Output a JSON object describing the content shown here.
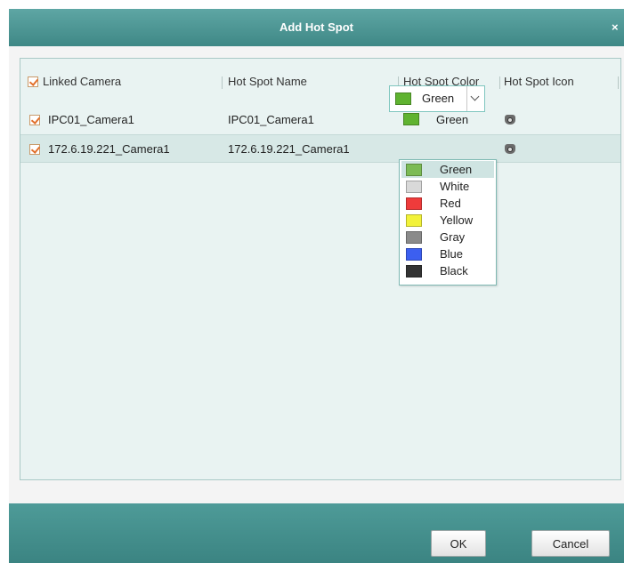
{
  "dialog": {
    "title": "Add Hot Spot",
    "close_glyph": "×"
  },
  "table": {
    "headers": {
      "linked_camera": "Linked Camera",
      "hot_spot_name": "Hot Spot Name",
      "hot_spot_color": "Hot Spot Color",
      "hot_spot_icon": "Hot Spot Icon"
    },
    "header_checked": true,
    "rows": [
      {
        "checked": true,
        "camera": "IPC01_Camera1",
        "name": "IPC01_Camera1",
        "color": "Green",
        "color_hex": "#5fb330",
        "icon": "camera-icon"
      },
      {
        "checked": true,
        "camera": "172.6.19.221_Camera1",
        "name": "172.6.19.221_Camera1",
        "color": "Green",
        "color_hex": "#5fb330",
        "icon": "camera-icon"
      }
    ]
  },
  "color_dropdown": {
    "selected": "Green",
    "options": [
      {
        "label": "Green",
        "hex": "#7cbb55"
      },
      {
        "label": "White",
        "hex": "#d9d9d9"
      },
      {
        "label": "Red",
        "hex": "#ef3b3b"
      },
      {
        "label": "Yellow",
        "hex": "#f2f23a"
      },
      {
        "label": "Gray",
        "hex": "#8a8a8a"
      },
      {
        "label": "Blue",
        "hex": "#3c5ff0"
      },
      {
        "label": "Black",
        "hex": "#333333"
      }
    ]
  },
  "footer": {
    "ok_label": "OK",
    "cancel_label": "Cancel"
  },
  "colors": {
    "titlebar": "#4f9896",
    "footer": "#438c8a",
    "panel_bg": "#e9f3f2",
    "checkbox_mark": "#e2702c"
  }
}
